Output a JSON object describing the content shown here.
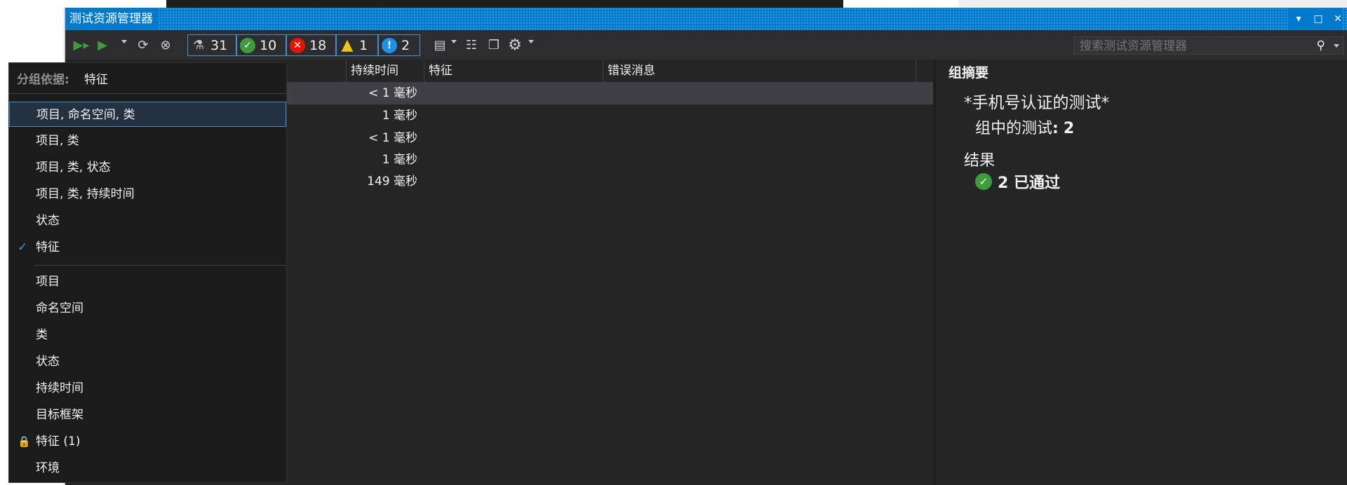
{
  "window": {
    "title": "测试资源管理器"
  },
  "toolbar": {
    "counters": [
      {
        "name": "all",
        "value": "31",
        "color": "#c8c8c8"
      },
      {
        "name": "passed",
        "value": "10",
        "color": "#3d9d3d"
      },
      {
        "name": "failed",
        "value": "18",
        "color": "#e51400"
      },
      {
        "name": "warning",
        "value": "1",
        "color": "#f0c419"
      },
      {
        "name": "info",
        "value": "2",
        "color": "#1e90e6"
      }
    ],
    "search_placeholder": "搜索测试资源管理器"
  },
  "grid": {
    "columns": [
      "持续时间",
      "特征",
      "错误消息"
    ],
    "durations": [
      "< 1 毫秒",
      "1 毫秒",
      "< 1 毫秒",
      "1 毫秒",
      "149 毫秒"
    ]
  },
  "summary": {
    "heading": "组摘要",
    "group_name": "*手机号认证的测试*",
    "count_label": "组中的测试",
    "count_sep": ":",
    "count_value": "2",
    "results_label": "结果",
    "passed_text": "2 已通过"
  },
  "menu": {
    "header_label": "分组依据:",
    "header_value": "特征",
    "group_items": [
      "项目, 命名空间, 类",
      "项目, 类",
      "项目, 类, 状态",
      "项目, 类, 持续时间",
      "状态",
      "特征"
    ],
    "field_items": [
      "项目",
      "命名空间",
      "类",
      "状态",
      "持续时间",
      "目标框架",
      "特征 (1)",
      "环境"
    ],
    "checkmark": "✓",
    "lock": "🔒"
  },
  "colors": {
    "accent": "#007acc",
    "selection_border": "#3e91d6",
    "background": "#252526"
  }
}
